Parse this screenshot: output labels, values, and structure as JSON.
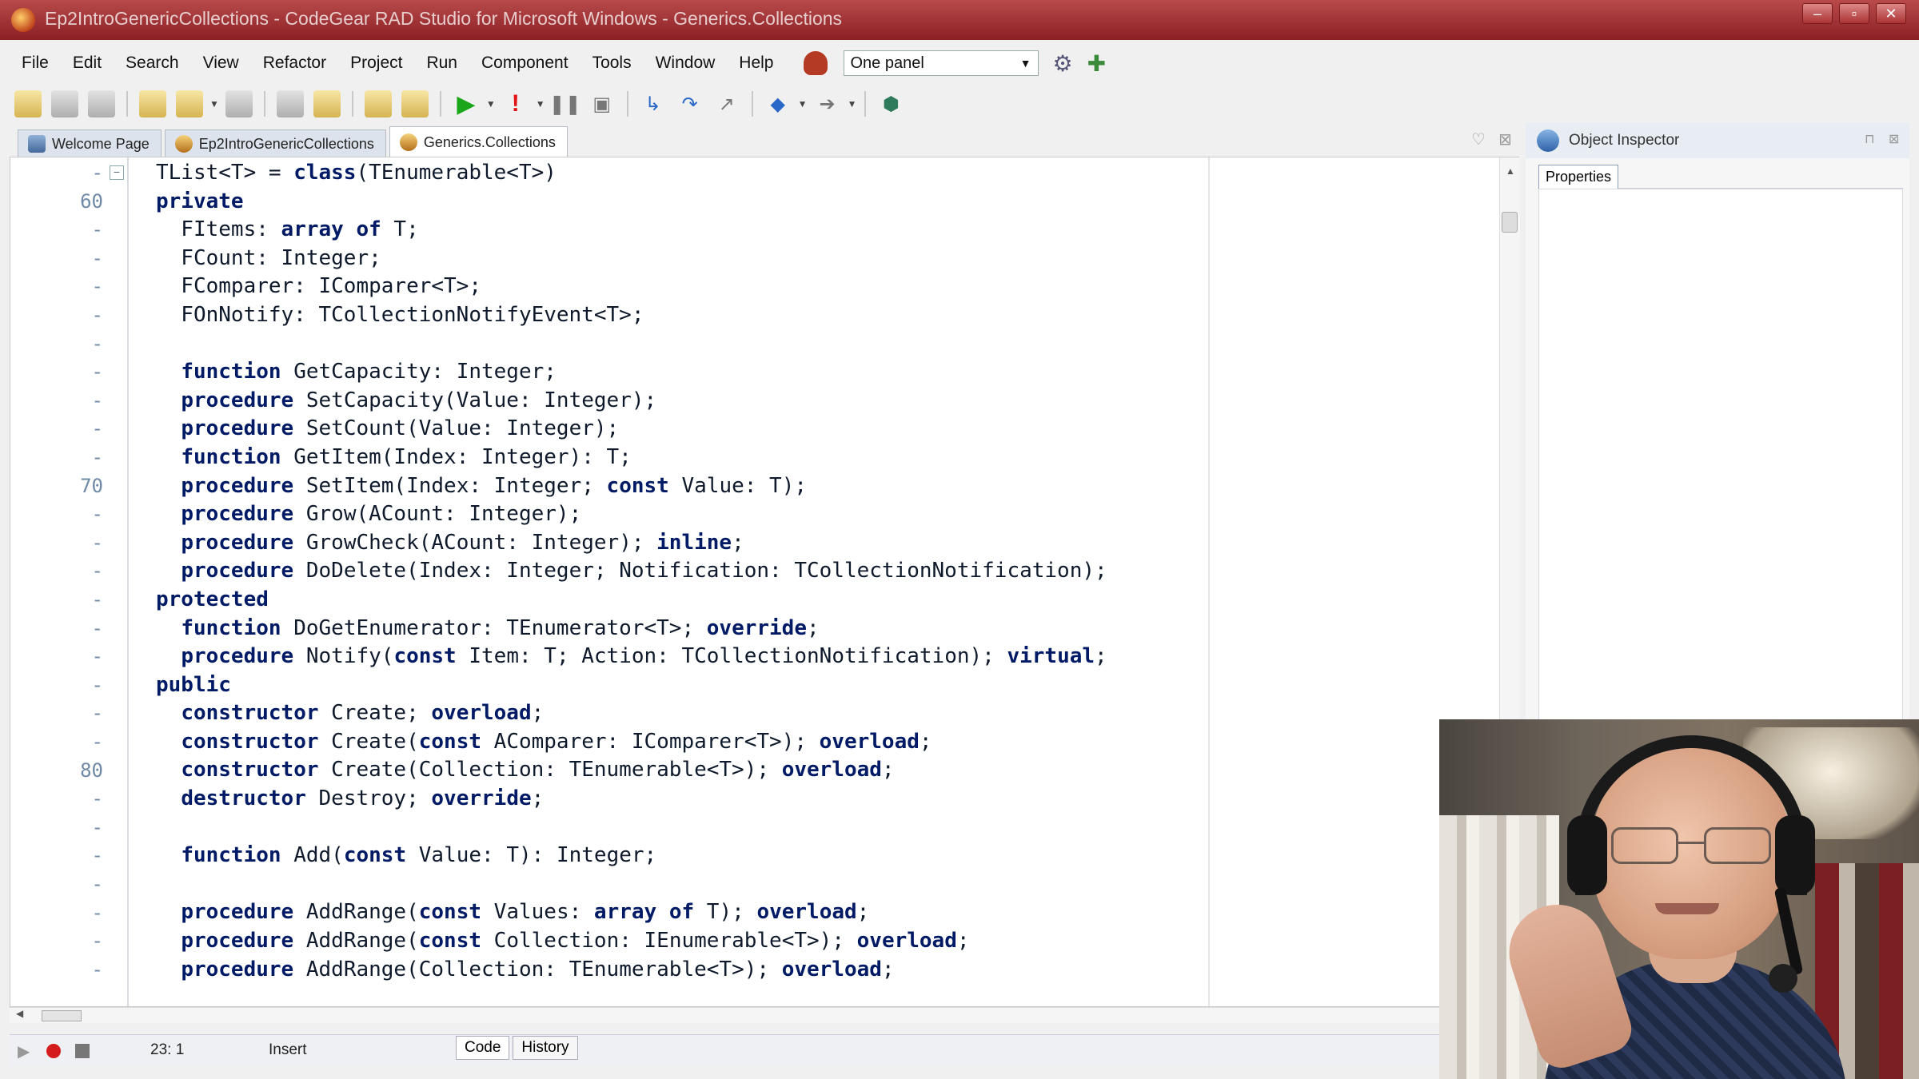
{
  "window": {
    "title": "Ep2IntroGenericCollections - CodeGear RAD Studio for Microsoft Windows - Generics.Collections",
    "controls": [
      "–",
      "▫",
      "✕"
    ]
  },
  "menu": {
    "items": [
      "File",
      "Edit",
      "Search",
      "View",
      "Refactor",
      "Project",
      "Run",
      "Component",
      "Tools",
      "Window",
      "Help"
    ],
    "layout_combo_value": "One panel"
  },
  "tabs": [
    {
      "label": "Welcome Page"
    },
    {
      "label": "Ep2IntroGenericCollections"
    },
    {
      "label": "Generics.Collections"
    }
  ],
  "editor": {
    "line_numbers": [
      "-",
      "60",
      "-",
      "-",
      "-",
      "-",
      "-",
      "-",
      "-",
      "-",
      "-",
      "70",
      "-",
      "-",
      "-",
      "-",
      "-",
      "-",
      "-",
      "-",
      "-",
      "80",
      "-",
      "-",
      "-",
      "-",
      "-",
      "-",
      "-"
    ],
    "lines": [
      [
        {
          "t": "TList<T> = "
        },
        {
          "t": "class",
          "k": true
        },
        {
          "t": "(TEnumerable<T>)"
        }
      ],
      [
        {
          "t": "private",
          "k": true
        }
      ],
      [
        {
          "t": "  FItems: "
        },
        {
          "t": "array of",
          "k": true
        },
        {
          "t": " T;"
        }
      ],
      [
        {
          "t": "  FCount: Integer;"
        }
      ],
      [
        {
          "t": "  FComparer: IComparer<T>;"
        }
      ],
      [
        {
          "t": "  FOnNotify: TCollectionNotifyEvent<T>;"
        }
      ],
      [
        {
          "t": ""
        }
      ],
      [
        {
          "t": "  "
        },
        {
          "t": "function",
          "k": true
        },
        {
          "t": " GetCapacity: Integer;"
        }
      ],
      [
        {
          "t": "  "
        },
        {
          "t": "procedure",
          "k": true
        },
        {
          "t": " SetCapacity(Value: Integer);"
        }
      ],
      [
        {
          "t": "  "
        },
        {
          "t": "procedure",
          "k": true
        },
        {
          "t": " SetCount(Value: Integer);"
        }
      ],
      [
        {
          "t": "  "
        },
        {
          "t": "function",
          "k": true
        },
        {
          "t": " GetItem(Index: Integer): T;"
        }
      ],
      [
        {
          "t": "  "
        },
        {
          "t": "procedure",
          "k": true
        },
        {
          "t": " SetItem(Index: Integer; "
        },
        {
          "t": "const",
          "k": true
        },
        {
          "t": " Value: T);"
        }
      ],
      [
        {
          "t": "  "
        },
        {
          "t": "procedure",
          "k": true
        },
        {
          "t": " Grow(ACount: Integer);"
        }
      ],
      [
        {
          "t": "  "
        },
        {
          "t": "procedure",
          "k": true
        },
        {
          "t": " GrowCheck(ACount: Integer); "
        },
        {
          "t": "inline",
          "k": true
        },
        {
          "t": ";"
        }
      ],
      [
        {
          "t": "  "
        },
        {
          "t": "procedure",
          "k": true
        },
        {
          "t": " DoDelete(Index: Integer; Notification: TCollectionNotification);"
        }
      ],
      [
        {
          "t": "protected",
          "k": true
        }
      ],
      [
        {
          "t": "  "
        },
        {
          "t": "function",
          "k": true
        },
        {
          "t": " DoGetEnumerator: TEnumerator<T>; "
        },
        {
          "t": "override",
          "k": true
        },
        {
          "t": ";"
        }
      ],
      [
        {
          "t": "  "
        },
        {
          "t": "procedure",
          "k": true
        },
        {
          "t": " Notify("
        },
        {
          "t": "const",
          "k": true
        },
        {
          "t": " Item: T; Action: TCollectionNotification); "
        },
        {
          "t": "virtual",
          "k": true
        },
        {
          "t": ";"
        }
      ],
      [
        {
          "t": "public",
          "k": true
        }
      ],
      [
        {
          "t": "  "
        },
        {
          "t": "constructor",
          "k": true
        },
        {
          "t": " Create; "
        },
        {
          "t": "overload",
          "k": true
        },
        {
          "t": ";"
        }
      ],
      [
        {
          "t": "  "
        },
        {
          "t": "constructor",
          "k": true
        },
        {
          "t": " Create("
        },
        {
          "t": "const",
          "k": true
        },
        {
          "t": " AComparer: IComparer<T>); "
        },
        {
          "t": "overload",
          "k": true
        },
        {
          "t": ";"
        }
      ],
      [
        {
          "t": "  "
        },
        {
          "t": "constructor",
          "k": true
        },
        {
          "t": " Create(Collection: TEnumerable<T>); "
        },
        {
          "t": "overload",
          "k": true
        },
        {
          "t": ";"
        }
      ],
      [
        {
          "t": "  "
        },
        {
          "t": "destructor",
          "k": true
        },
        {
          "t": " Destroy; "
        },
        {
          "t": "override",
          "k": true
        },
        {
          "t": ";"
        }
      ],
      [
        {
          "t": ""
        }
      ],
      [
        {
          "t": "  "
        },
        {
          "t": "function",
          "k": true
        },
        {
          "t": " Add("
        },
        {
          "t": "const",
          "k": true
        },
        {
          "t": " Value: T): Integer;"
        }
      ],
      [
        {
          "t": ""
        }
      ],
      [
        {
          "t": "  "
        },
        {
          "t": "procedure",
          "k": true
        },
        {
          "t": " AddRange("
        },
        {
          "t": "const",
          "k": true
        },
        {
          "t": " Values: "
        },
        {
          "t": "array of",
          "k": true
        },
        {
          "t": " T); "
        },
        {
          "t": "overload",
          "k": true
        },
        {
          "t": ";"
        }
      ],
      [
        {
          "t": "  "
        },
        {
          "t": "procedure",
          "k": true
        },
        {
          "t": " AddRange("
        },
        {
          "t": "const",
          "k": true
        },
        {
          "t": " Collection: IEnumerable<T>); "
        },
        {
          "t": "overload",
          "k": true
        },
        {
          "t": ";"
        }
      ],
      [
        {
          "t": "  "
        },
        {
          "t": "procedure",
          "k": true
        },
        {
          "t": " AddRange(Collection: TEnumerable<T>); "
        },
        {
          "t": "overload",
          "k": true
        },
        {
          "t": ";"
        }
      ]
    ]
  },
  "status": {
    "cursor_pos": "23:  1",
    "mode": "Insert",
    "bottom_tabs": [
      "Code",
      "History"
    ]
  },
  "object_inspector": {
    "title": "Object Inspector",
    "tab": "Properties"
  }
}
